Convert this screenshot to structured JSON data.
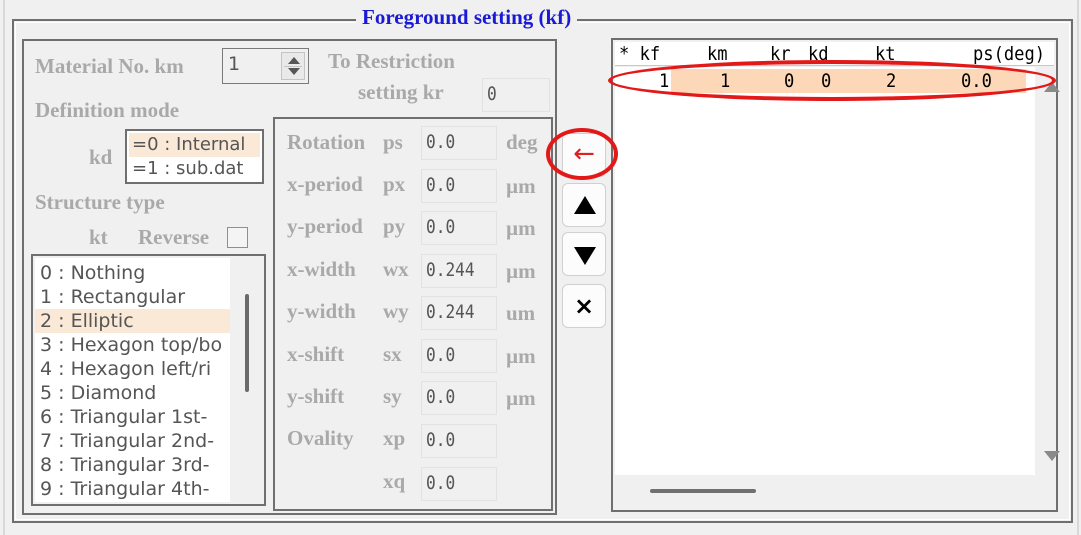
{
  "group": {
    "title": "Foreground setting (kf)"
  },
  "material": {
    "label": "Material No.  km",
    "value": "1",
    "restriction_label_line1": "To Restriction",
    "restriction_label_line2": "setting  kr",
    "restriction_value": "0"
  },
  "definition": {
    "label": "Definition mode",
    "kd_label": "kd",
    "options": [
      {
        "label": "=0 : Internal",
        "selected": true
      },
      {
        "label": "=1 : sub.dat",
        "selected": false
      }
    ]
  },
  "structure": {
    "label": "Structure type",
    "kt_label": "kt",
    "reverse_label": "Reverse",
    "reverse_checked": false,
    "types": [
      {
        "label": "0 : Nothing",
        "selected": false
      },
      {
        "label": "1 : Rectangular",
        "selected": false
      },
      {
        "label": "2 : Elliptic",
        "selected": true
      },
      {
        "label": "3 : Hexagon top/bo",
        "selected": false
      },
      {
        "label": "4 : Hexagon left/ri",
        "selected": false
      },
      {
        "label": "5 : Diamond",
        "selected": false
      },
      {
        "label": "6 : Triangular 1st-",
        "selected": false
      },
      {
        "label": "7 : Triangular 2nd-",
        "selected": false
      },
      {
        "label": "8 : Triangular 3rd-",
        "selected": false
      },
      {
        "label": "9 : Triangular 4th-",
        "selected": false
      }
    ]
  },
  "params": [
    {
      "name": "Rotation",
      "sym": "ps",
      "value": "0.0",
      "unit": "deg"
    },
    {
      "name": "x-period",
      "sym": "px",
      "value": "0.0",
      "unit": "µm"
    },
    {
      "name": "y-period",
      "sym": "py",
      "value": "0.0",
      "unit": "µm"
    },
    {
      "name": "x-width",
      "sym": "wx",
      "value": "0.244",
      "unit": "µm"
    },
    {
      "name": "y-width",
      "sym": "wy",
      "value": "0.244",
      "unit": "um"
    },
    {
      "name": "x-shift",
      "sym": "sx",
      "value": "0.0",
      "unit": "µm"
    },
    {
      "name": "y-shift",
      "sym": "sy",
      "value": "0.0",
      "unit": "µm"
    },
    {
      "name": "Ovality",
      "sym": "xp",
      "value": "0.0",
      "unit": ""
    },
    {
      "name": "",
      "sym": "xq",
      "value": "0.0",
      "unit": ""
    }
  ],
  "buttons": {
    "register": "←",
    "move_up": "up-arrow",
    "move_down": "down-arrow",
    "delete": "×"
  },
  "table": {
    "columns": [
      "* kf",
      "km",
      "kr",
      "kd",
      "kt",
      "ps(deg)"
    ],
    "rows": [
      {
        "kf": "1",
        "km": "1",
        "kr": "0",
        "kd": "0",
        "kt": "2",
        "ps": "0.0",
        "selected": true
      }
    ]
  },
  "colors": {
    "title_blue": "#1a1ad6",
    "annotation_red": "#e31818",
    "selection": "#fcd8b8"
  }
}
